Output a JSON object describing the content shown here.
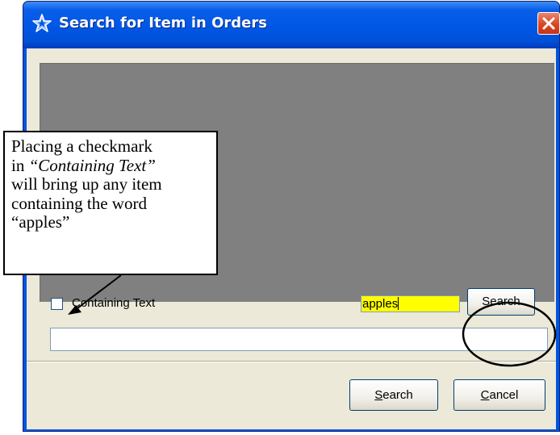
{
  "window": {
    "title": "Search for Item in Orders"
  },
  "results_panel": {
    "background_color": "#808080"
  },
  "options": {
    "containing_text_label": "Containing Text",
    "containing_text_checked": false
  },
  "search": {
    "input_value": "apples",
    "input_background": "#ffff00",
    "button_label": "Search"
  },
  "footer": {
    "search_button_mnemonic": "S",
    "search_button_rest": "earch",
    "cancel_button_mnemonic": "C",
    "cancel_button_rest": "ancel"
  },
  "callout": {
    "line1": "Placing a checkmark",
    "line2_prefix": "in ",
    "line2_italic": "“Containing Text”",
    "line3": "will bring up any item",
    "line4": "containing the word",
    "line5": "“apples”"
  },
  "icons": {
    "title_icon": "star-outline-icon",
    "close_icon": "x-icon"
  }
}
